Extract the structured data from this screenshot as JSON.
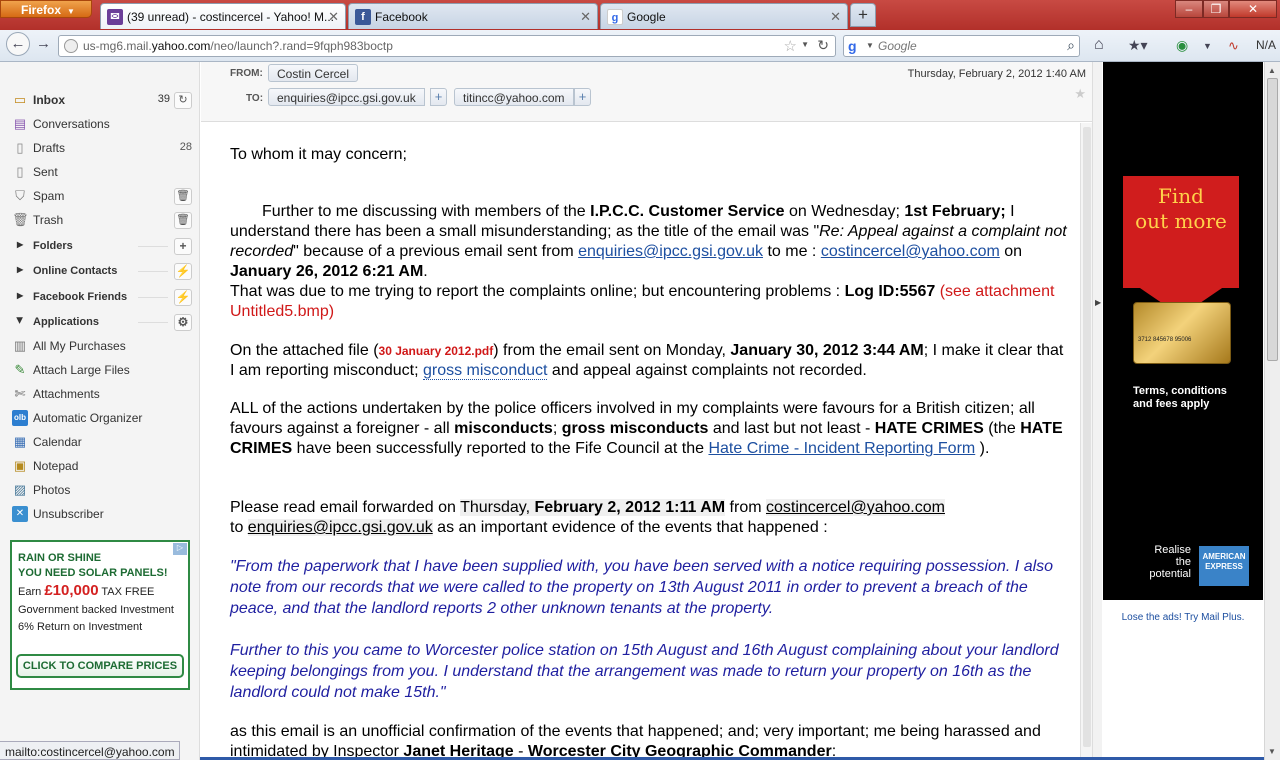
{
  "browser": {
    "menu_label": "Firefox",
    "tabs": [
      {
        "label": "(39 unread) - costincercel - Yahoo! M...",
        "icon": "yahoo-mail-icon"
      },
      {
        "label": "Facebook",
        "icon": "facebook-icon"
      },
      {
        "label": "Google",
        "icon": "google-icon"
      }
    ],
    "url_prefix": "us-mg6.mail.",
    "url_domain": "yahoo.com",
    "url_rest": "/neo/launch?.rand=9fqph983boctp",
    "search_placeholder": "Google",
    "na_label": "N/A",
    "status_text": "mailto:costincercel@yahoo.com"
  },
  "sidebar": {
    "folders_top": [
      {
        "label": "Inbox",
        "count": "39",
        "icon": "inbox-icon",
        "selected": true
      },
      {
        "label": "Conversations",
        "icon": "conversations-icon"
      },
      {
        "label": "Drafts",
        "count": "28",
        "icon": "drafts-icon"
      },
      {
        "label": "Sent",
        "icon": "sent-icon"
      },
      {
        "label": "Spam",
        "icon": "spam-icon"
      },
      {
        "label": "Trash",
        "icon": "trash-icon"
      }
    ],
    "sections": [
      {
        "label": "Folders"
      },
      {
        "label": "Online Contacts"
      },
      {
        "label": "Facebook Friends"
      },
      {
        "label": "Applications"
      }
    ],
    "apps": [
      {
        "label": "All My Purchases",
        "icon": "purchases-icon"
      },
      {
        "label": "Attach Large Files",
        "icon": "attach-icon"
      },
      {
        "label": "Attachments",
        "icon": "attachments-icon"
      },
      {
        "label": "Automatic Organizer",
        "icon": "organizer-icon"
      },
      {
        "label": "Calendar",
        "icon": "calendar-icon"
      },
      {
        "label": "Notepad",
        "icon": "notepad-icon"
      },
      {
        "label": "Photos",
        "icon": "photos-icon"
      },
      {
        "label": "Unsubscriber",
        "icon": "unsubscriber-icon"
      }
    ]
  },
  "solar_ad": {
    "line1": "RAIN OR SHINE",
    "line2": "YOU NEED SOLAR PANELS!",
    "earn": "Earn",
    "amount": "£10,000",
    "taxfree": "TAX FREE",
    "line4": "Government backed Investment",
    "line5": "6% Return on Investment",
    "cta": "CLICK TO COMPARE PRICES"
  },
  "message": {
    "from_label": "FROM:",
    "from": "Costin Cercel",
    "to_label": "TO:",
    "to": [
      "enquiries@ipcc.gsi.gov.uk",
      "titincc@yahoo.com"
    ],
    "date": "Thursday, February 2, 2012 1:40 AM",
    "greeting": "To whom it may concern;",
    "p1": {
      "a": "Further to me discussing with members of the ",
      "b": "I.P.C.C. Customer Service",
      "c": " on Wednesday; ",
      "d": "1st February;",
      "e": " I understand there has been a small misunderstanding; as the title of the email was \"",
      "f": "Re: Appeal against a complaint not recorded",
      "g": "\" because of a previous email sent from ",
      "h": "enquiries@ipcc.gsi.gov.uk",
      "i": " to me : ",
      "j": "costincercel@yahoo.com",
      "k": " on ",
      "l": "January 26, 2012 6:21 AM",
      "m": "."
    },
    "p1b": {
      "a": "That was due to me trying to report the complaints online; but encountering problems : ",
      "b": "Log ID:5567",
      "c": " (see attachment Untitled5.bmp)"
    },
    "p2": {
      "a": "On the attached file (",
      "b": "30 January 2012.pdf",
      "c": ") from the email sent on  Monday, ",
      "d": "January 30, 2012 3:44 AM",
      "e": "; I make it clear that I am reporting misconduct; ",
      "f": "gross misconduct",
      "g": " and appeal against complaints not recorded."
    },
    "p3": {
      "a": "ALL of the actions undertaken by the police officers involved in my complaints were favours for a British citizen; all favours against a foreigner - all ",
      "b": "misconducts",
      "c": "; ",
      "d": "gross misconducts",
      "e": " and last but not least - ",
      "f": "HATE CRIMES",
      "g": " (the ",
      "h": "HATE CRIMES",
      "i": " have been successfully reported to the Fife Council at the ",
      "j": "Hate Crime - Incident Reporting Form",
      "k": " )."
    },
    "p4": {
      "a": "Please read email forwarded on ",
      "b": "Thursday, ",
      "c": "February 2, 2012 1:11 AM",
      "d": " from ",
      "e": "costincercel@yahoo.com",
      "f": "to ",
      "g": "enquiries@ipcc.gsi.gov.uk",
      "h": " as an important evidence of the events that happened :"
    },
    "quote1": "\"From the paperwork that I have been supplied with, you have been served with a notice requiring possession.  I also note from our records that we were called to the property on 13th August 2011 in order to prevent a breach of the peace, and that the landlord reports 2 other unknown tenants at the property.",
    "quote2": "Further to this you came to Worcester police station on 15th August and 16th August complaining about your landlord keeping belongings from you.  I understand that the arrangement was made to return your property on 16th as the landlord could not make 15th.\"",
    "p5": {
      "a": "as this email is an unofficial confirmation of the events that happened; and; very important; me being harassed and intimidated by Inspector ",
      "b": "Janet Heritage",
      "c": " - ",
      "d": "Worcester City Geographic Commander",
      "e": ":"
    }
  },
  "right_ad": {
    "headline1": "Find",
    "headline2": "out more",
    "card_number": "3712  845678  95006",
    "terms1": "Terms, conditions",
    "terms2": "and fees apply",
    "realise1": "Realise",
    "realise2": "the",
    "realise3": "potential",
    "amex1": "AMERICAN",
    "amex2": "EXPRESS",
    "lose_ads": "Lose the ads! Try Mail Plus."
  },
  "colors": {
    "titlebar": "#b2302a",
    "firefox_button": "#e27b24",
    "link": "#1d4fa0",
    "quote": "#1f1fa0",
    "attention": "#d01818"
  }
}
